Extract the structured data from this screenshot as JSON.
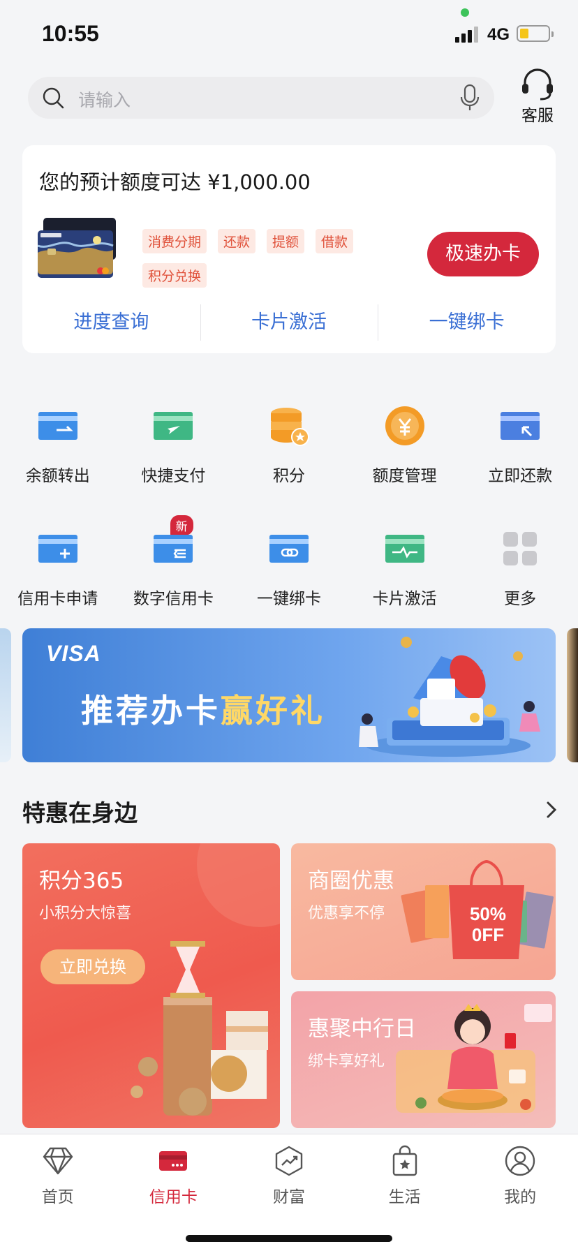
{
  "status_bar": {
    "time": "10:55",
    "network": "4G"
  },
  "search": {
    "placeholder": "请输入",
    "service_label": "客服"
  },
  "quota_card": {
    "title": "您的预计额度可达 ¥1,000.00",
    "tags": [
      "消费分期",
      "还款",
      "提额",
      "借款",
      "积分兑换"
    ],
    "apply_button": "极速办卡",
    "links": [
      "进度查询",
      "卡片激活",
      "一键绑卡"
    ]
  },
  "quick_actions": {
    "row1": [
      {
        "label": "余额转出",
        "icon": "balance-transfer-card-icon"
      },
      {
        "label": "快捷支付",
        "icon": "quick-pay-card-icon"
      },
      {
        "label": "积分",
        "icon": "points-coins-icon"
      },
      {
        "label": "额度管理",
        "icon": "limit-yen-icon"
      },
      {
        "label": "立即还款",
        "icon": "repay-card-icon"
      }
    ],
    "row2": [
      {
        "label": "信用卡申请",
        "icon": "card-apply-plus-icon"
      },
      {
        "label": "数字信用卡",
        "icon": "digital-card-icon",
        "badge": "新"
      },
      {
        "label": "一键绑卡",
        "icon": "bind-card-link-icon"
      },
      {
        "label": "卡片激活",
        "icon": "activate-card-pulse-icon"
      },
      {
        "label": "更多",
        "icon": "more-grid-icon"
      }
    ]
  },
  "banner": {
    "brand": "VISA",
    "slogan_white": "推荐办卡",
    "slogan_yellow": "赢好礼"
  },
  "section": {
    "title": "特惠在身边",
    "promos": [
      {
        "title": "积分365",
        "subtitle": "小积分大惊喜",
        "button": "立即兑换"
      },
      {
        "title": "商圈优惠",
        "subtitle": "优惠享不停",
        "sale_line1": "50%",
        "sale_line2": "0FF"
      },
      {
        "title": "惠聚中行日",
        "subtitle": "绑卡享好礼"
      }
    ]
  },
  "tab_bar": {
    "active": "信用卡",
    "items": [
      "首页",
      "信用卡",
      "财富",
      "生活",
      "我的"
    ]
  },
  "colors": {
    "brand_red": "#d4283c",
    "link_blue": "#3a6fd4",
    "tag_bg": "#fde9e3",
    "tag_text": "#e0533c"
  }
}
